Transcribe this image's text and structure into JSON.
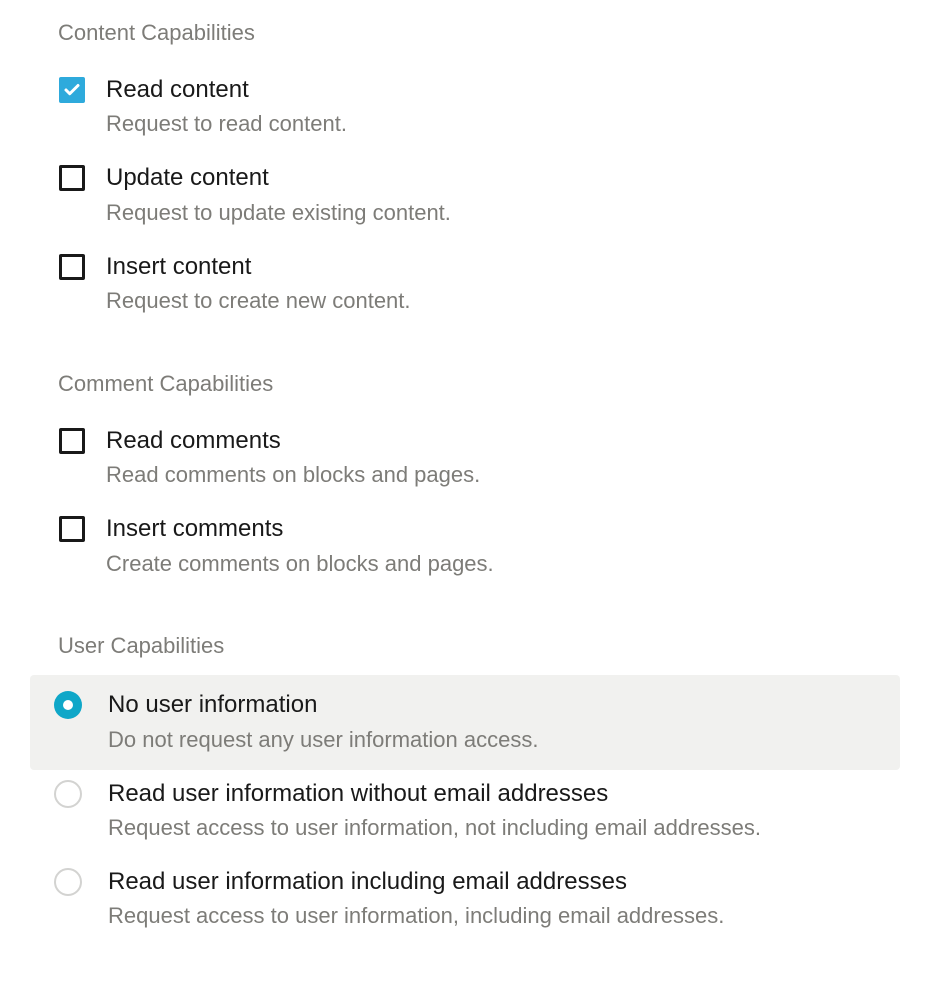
{
  "sections": {
    "content": {
      "header": "Content Capabilities",
      "items": [
        {
          "title": "Read content",
          "desc": "Request to read content.",
          "checked": true
        },
        {
          "title": "Update content",
          "desc": "Request to update existing content.",
          "checked": false
        },
        {
          "title": "Insert content",
          "desc": "Request to create new content.",
          "checked": false
        }
      ]
    },
    "comment": {
      "header": "Comment Capabilities",
      "items": [
        {
          "title": "Read comments",
          "desc": "Read comments on blocks and pages.",
          "checked": false
        },
        {
          "title": "Insert comments",
          "desc": "Create comments on blocks and pages.",
          "checked": false
        }
      ]
    },
    "user": {
      "header": "User Capabilities",
      "items": [
        {
          "title": "No user information",
          "desc": "Do not request any user information access.",
          "selected": true
        },
        {
          "title": "Read user information without email addresses",
          "desc": "Request access to user information, not including email addresses.",
          "selected": false
        },
        {
          "title": "Read user information including email addresses",
          "desc": "Request access to user information, including email addresses.",
          "selected": false
        }
      ]
    }
  }
}
